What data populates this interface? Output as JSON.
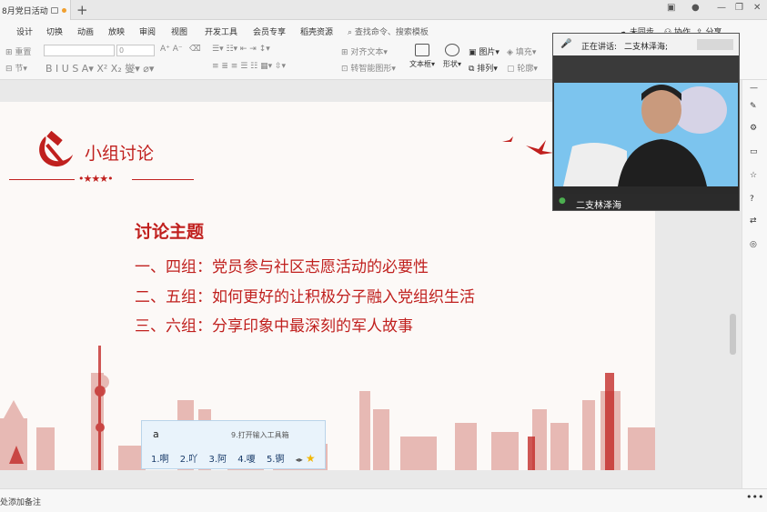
{
  "tab": {
    "title": "8月党日活动"
  },
  "menu": [
    "设计",
    "切换",
    "动画",
    "放映",
    "审阅",
    "视图",
    "开发工具",
    "会员专享",
    "稻壳资源"
  ],
  "search": {
    "placeholder": "查找命令、搜索模板"
  },
  "header_actions": {
    "unsync": "未同步",
    "collab": "协作",
    "share": "分享"
  },
  "toolbar": {
    "reset": "重置",
    "section": "节",
    "font_size": "0",
    "align_text": "对齐文本",
    "smart_shape": "转智能图形",
    "textbox": "文本框",
    "shape": "形状",
    "picture": "图片",
    "arrange": "排列",
    "fill": "填充",
    "outline": "轮廓"
  },
  "slide": {
    "title": "小组讨论",
    "topic_title": "讨论主题",
    "topics": [
      "一、四组：党员参与社区志愿活动的必要性",
      "二、五组：如何更好的让积极分子融入党组织生活",
      "三、六组：分享印象中最深刻的军人故事"
    ]
  },
  "video": {
    "speaking_label": "正在讲话:",
    "speaking_name": "二支林泽海;",
    "participant": "二支林泽海"
  },
  "ime": {
    "input": "a",
    "toolbox": "9.打开输入工具箱",
    "candidates": [
      "1.啊",
      "2.吖",
      "3.阿",
      "4.嗄",
      "5.锕"
    ]
  },
  "status": {
    "note_hint": "处添加备注"
  },
  "colors": {
    "party_red": "#c0201e",
    "video_bg": "#7cc4ee"
  }
}
